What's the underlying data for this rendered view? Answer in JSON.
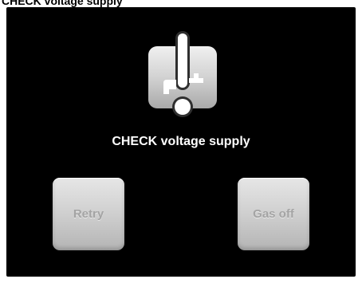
{
  "window": {
    "title": "CHECK voltage supply"
  },
  "dialog": {
    "icon": "faucet-warning-icon",
    "message": "CHECK voltage supply"
  },
  "buttons": {
    "retry_label": "Retry",
    "gas_off_label": "Gas off"
  },
  "colors": {
    "screen_background": "#000000",
    "message_text": "#ffffff",
    "button_face": "#d0d0d0",
    "button_text": "#a4a4a4",
    "icon_tile": "#cfcfcf"
  }
}
